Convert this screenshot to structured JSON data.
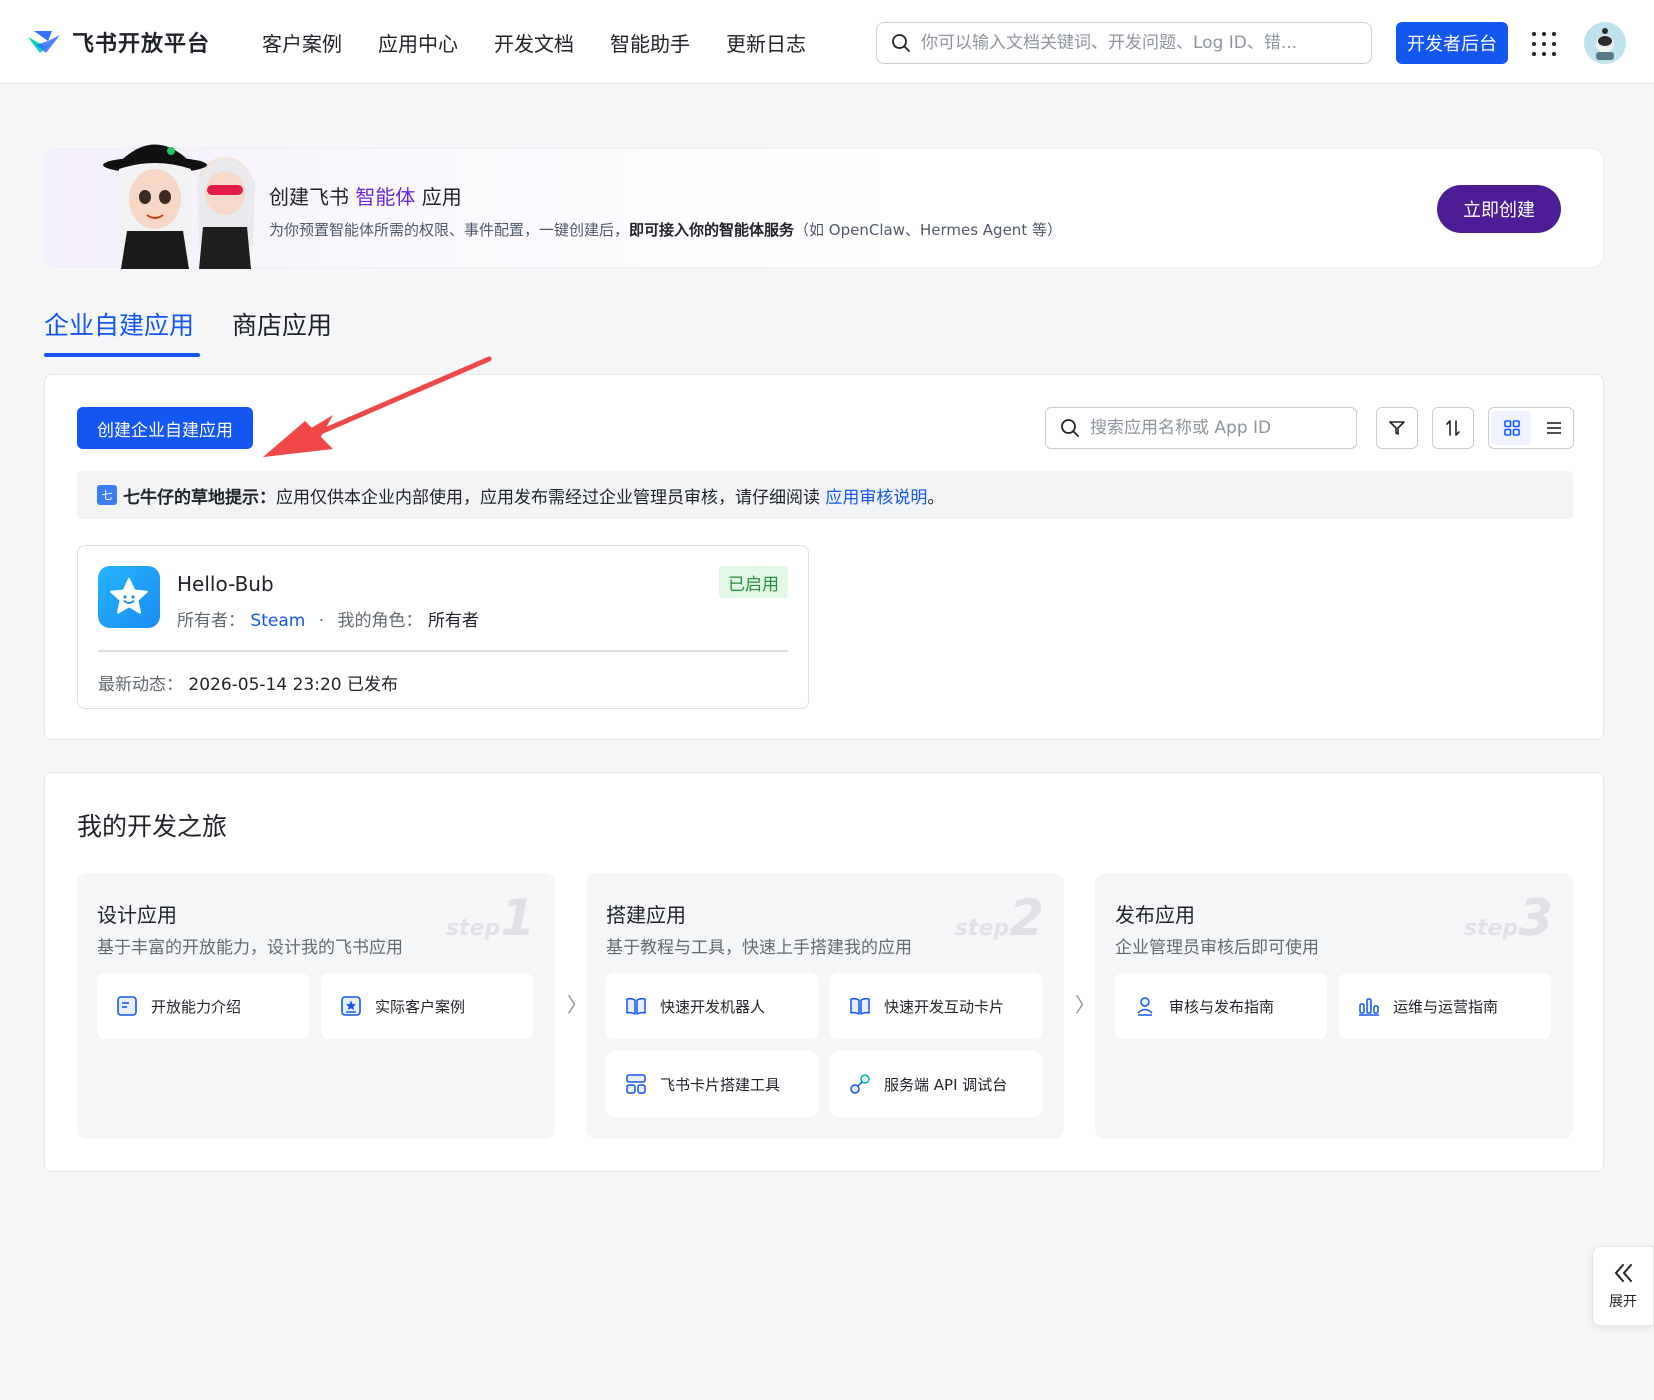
{
  "header": {
    "logo_text": "飞书开放平台",
    "nav": [
      "客户案例",
      "应用中心",
      "开发文档",
      "智能助手",
      "更新日志"
    ],
    "search_placeholder": "你可以输入文档关键词、开发问题、Log ID、错...",
    "dev_console_label": "开发者后台"
  },
  "banner": {
    "title_prefix": "创建飞书",
    "title_highlight": "智能体",
    "title_suffix": "应用",
    "description_prefix": "为你预置智能体所需的权限、事件配置，一键创建后，",
    "description_strong": "即可接入你的智能体服务",
    "description_suffix": "（如 OpenClaw、Hermes Agent 等）",
    "button_label": "立即创建"
  },
  "tabs": [
    {
      "label": "企业自建应用",
      "active": true
    },
    {
      "label": "商店应用",
      "active": false
    }
  ],
  "apps_panel": {
    "create_button_label": "创建企业自建应用",
    "search_placeholder": "搜索应用名称或 App ID",
    "notice": {
      "icon_letter": "七",
      "title": "七牛仔的草地提示：",
      "text": "应用仅供本企业内部使用，应用发布需经过企业管理员审核，请仔细阅读 ",
      "link": "应用审核说明",
      "end": "。"
    },
    "apps": [
      {
        "name": "Hello-Bub",
        "owner_label": "所有者：",
        "owner": "Steam",
        "separator": "·",
        "role_label": "我的角色：",
        "role": "所有者",
        "status": "已启用",
        "latest_label": "最新动态：",
        "latest_value": "2026-05-14 23:20 已发布"
      }
    ]
  },
  "journey": {
    "title": "我的开发之旅",
    "steps": [
      {
        "title": "设计应用",
        "desc": "基于丰富的开放能力，设计我的飞书应用",
        "mark_word": "step",
        "mark_num": "1",
        "items": [
          {
            "label": "开放能力介绍",
            "icon": "doc-icon"
          },
          {
            "label": "实际客户案例",
            "icon": "star-doc-icon"
          }
        ]
      },
      {
        "title": "搭建应用",
        "desc": "基于教程与工具，快速上手搭建我的应用",
        "mark_word": "step",
        "mark_num": "2",
        "items": [
          {
            "label": "快速开发机器人",
            "icon": "book-icon"
          },
          {
            "label": "快速开发互动卡片",
            "icon": "book-icon"
          },
          {
            "label": "飞书卡片搭建工具",
            "icon": "card-builder-icon"
          },
          {
            "label": "服务端 API 调试台",
            "icon": "api-link-icon"
          }
        ]
      },
      {
        "title": "发布应用",
        "desc": "企业管理员审核后即可使用",
        "mark_word": "step",
        "mark_num": "3",
        "items": [
          {
            "label": "审核与发布指南",
            "icon": "user-review-icon"
          },
          {
            "label": "运维与运营指南",
            "icon": "chart-icon"
          }
        ]
      }
    ]
  },
  "expand_label": "展开",
  "colors": {
    "primary": "#1456f0",
    "banner_button": "#4c1d95",
    "highlight_purple": "#6d28d9",
    "enabled_badge": "#24913e",
    "annotation_arrow": "#f04848"
  }
}
